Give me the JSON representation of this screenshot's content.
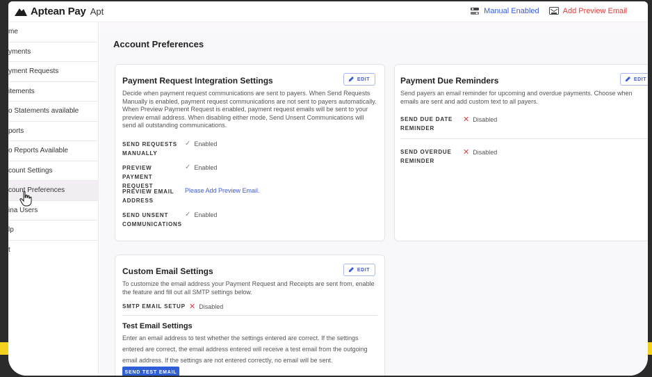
{
  "app": {
    "brand_name": "Aptean Pay",
    "brand_suffix": "Apt",
    "top_actions": [
      {
        "label": "Manual Enabled",
        "icon": "toggle-icon",
        "color": "#3b5bd6"
      },
      {
        "label": "Add Preview Email",
        "icon": "preview-email-icon",
        "color": "#d94040"
      }
    ]
  },
  "sidebar": {
    "items": [
      {
        "label": "me"
      },
      {
        "label": "yments"
      },
      {
        "label": "yment Requests"
      },
      {
        "label": "itements"
      },
      {
        "label": "o Statements available"
      },
      {
        "label": "ports"
      },
      {
        "label": "o Reports Available"
      },
      {
        "label": "count Settings"
      },
      {
        "label": "count Preferences",
        "active": true
      },
      {
        "label": "ina     Users"
      },
      {
        "label": "lp"
      },
      {
        "label": "t"
      }
    ]
  },
  "main": {
    "page_title": "Account Preferences",
    "payment_request_card": {
      "title": "Payment Request Integration Settings",
      "edit_label": "EDIT",
      "description": "Decide when payment request communications are sent to payers. When Send Requests Manually is enabled, payment request communications are not sent to payers automatically. When Preview Payment Request is enabled, payment request emails will be sent to your preview email address. When disabling either mode, Send Unsent Communications will send all outstanding communications.",
      "settings": [
        {
          "label": "SEND REQUESTS MANUALLY",
          "value": "Enabled",
          "state": "enabled"
        },
        {
          "label": "PREVIEW PAYMENT REQUEST",
          "value": "Enabled",
          "state": "enabled"
        },
        {
          "label": "PREVIEW EMAIL ADDRESS",
          "value": "Please Add Preview Email.",
          "state": "link"
        },
        {
          "label": "SEND UNSENT COMMUNICATIONS",
          "value": "Enabled",
          "state": "enabled"
        }
      ]
    },
    "due_reminders_card": {
      "title": "Payment Due Reminders",
      "edit_label": "EDIT",
      "description": "Send payers an email reminder for upcoming and overdue payments. Choose when emails are sent and add custom text to all payers.",
      "settings": [
        {
          "label": "SEND DUE DATE REMINDER",
          "value": "Disabled",
          "state": "disabled"
        },
        {
          "label": "SEND OVERDUE REMINDER",
          "value": "Disabled",
          "state": "disabled"
        }
      ]
    },
    "custom_email_card": {
      "title": "Custom Email Settings",
      "edit_label": "EDIT",
      "description": "To customize the email address your Payment Request and Receipts are sent from, enable the feature and fill out all SMTP settings below.",
      "smtp_label": "SMTP EMAIL SETUP",
      "smtp_value": "Disabled",
      "test_heading": "Test Email Settings",
      "test_text": "Enter an email address to test whether the settings entered are correct. If the settings entered are correct, the email address entered will receive a test email from the outgoing email address. If the settings are not entered correctly, no email will be sent.",
      "send_test_label": "SEND TEST EMAIL"
    }
  },
  "colors": {
    "accent": "#3b5bd6",
    "primary_button": "#2f5fd6",
    "error": "#e03a3a",
    "frame": "#2b2b2b",
    "highlight": "#f3d21f"
  }
}
